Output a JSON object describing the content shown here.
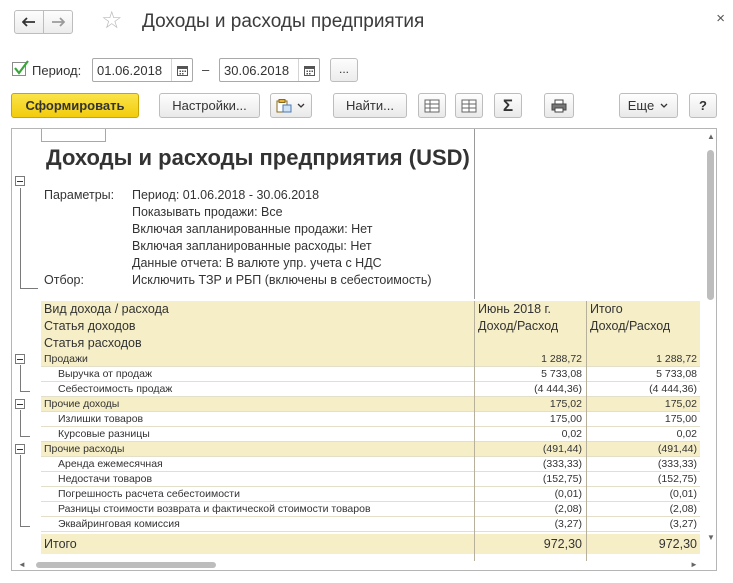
{
  "window": {
    "title": "Доходы и расходы предприятия",
    "close_glyph": "×"
  },
  "icons": {
    "back": "arrow-left-icon",
    "forward": "arrow-right-icon",
    "favorite": "star-icon",
    "calendar": "calendar-icon",
    "checkbox": "check-icon",
    "print": "printer-icon",
    "sum": "sigma-icon"
  },
  "period": {
    "checked": true,
    "label": "Период:",
    "from": "01.06.2018",
    "dash": "–",
    "to": "30.06.2018",
    "more_label": "..."
  },
  "toolbar": {
    "generate_label": "Сформировать",
    "settings_label": "Настройки...",
    "find_label": "Найти...",
    "sum_label": "Σ",
    "more_label": "Еще",
    "help_label": "?"
  },
  "report": {
    "title": "Доходы и расходы предприятия (USD)",
    "params": [
      {
        "label": "Параметры:",
        "value": "Период: 01.06.2018 - 30.06.2018"
      },
      {
        "label": "",
        "value": "Показывать продажи: Все"
      },
      {
        "label": "",
        "value": "Включая запланированные продажи: Нет"
      },
      {
        "label": "",
        "value": "Включая запланированные расходы: Нет"
      },
      {
        "label": "",
        "value": "Данные отчета: В валюте упр. учета с НДС"
      },
      {
        "label": "Отбор:",
        "value": "Исключить ТЗР и РБП (включены в себестоимость)"
      }
    ],
    "header": {
      "col1": [
        "Вид дохода / расхода",
        "Статья доходов",
        "Статья расходов"
      ],
      "col2": [
        "Июнь 2018 г.",
        "Доход/Расход"
      ],
      "col3": [
        "Итого",
        "Доход/Расход"
      ]
    },
    "rows": [
      {
        "name": "Продажи",
        "group": true,
        "v1": "1 288,72",
        "v2": "1 288,72"
      },
      {
        "name": "Выручка от продаж",
        "group": false,
        "v1": "5 733,08",
        "v2": "5 733,08"
      },
      {
        "name": "Себестоимость продаж",
        "group": false,
        "v1": "(4 444,36)",
        "v2": "(4 444,36)"
      },
      {
        "name": "Прочие доходы",
        "group": true,
        "v1": "175,02",
        "v2": "175,02"
      },
      {
        "name": "Излишки товаров",
        "group": false,
        "v1": "175,00",
        "v2": "175,00"
      },
      {
        "name": "Курсовые разницы",
        "group": false,
        "v1": "0,02",
        "v2": "0,02"
      },
      {
        "name": "Прочие расходы",
        "group": true,
        "v1": "(491,44)",
        "v2": "(491,44)"
      },
      {
        "name": "Аренда ежемесячная",
        "group": false,
        "v1": "(333,33)",
        "v2": "(333,33)"
      },
      {
        "name": "Недостачи товаров",
        "group": false,
        "v1": "(152,75)",
        "v2": "(152,75)"
      },
      {
        "name": "Погрешность расчета себестоимости",
        "group": false,
        "v1": "(0,01)",
        "v2": "(0,01)"
      },
      {
        "name": "Разницы стоимости возврата и фактической стоимости товаров",
        "group": false,
        "v1": "(2,08)",
        "v2": "(2,08)"
      },
      {
        "name": "Эквайринговая комиссия",
        "group": false,
        "v1": "(3,27)",
        "v2": "(3,27)"
      }
    ],
    "total": {
      "name": "Итого",
      "v1": "972,30",
      "v2": "972,30"
    }
  },
  "colors": {
    "primary_button": "#f2cc0c",
    "table_header": "#f5eec7",
    "checkbox_check": "#3aa63a"
  }
}
